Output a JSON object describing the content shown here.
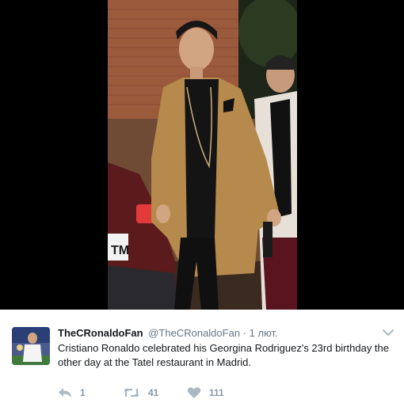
{
  "tweet": {
    "display_name": "TheCRonaldoFan",
    "handle": "@TheCRonaldoFan",
    "separator": "·",
    "timestamp": "1 лют.",
    "text": "Cristiano Ronaldo celebrated his Georgina Rodriguez's 23rd birthday the other day at the Tatel restaurant in Madrid."
  },
  "actions": {
    "reply_count": "1",
    "retweet_count": "41",
    "like_count": "111"
  },
  "photo": {
    "license_plate_text": "TM"
  },
  "colors": {
    "text_primary": "#14171a",
    "text_secondary": "#657786",
    "action_icon": "#aab8c2",
    "media_background": "#000000"
  },
  "icons": {
    "reply": "reply-icon",
    "retweet": "retweet-icon",
    "like": "heart-icon",
    "more": "chevron-down-icon"
  }
}
